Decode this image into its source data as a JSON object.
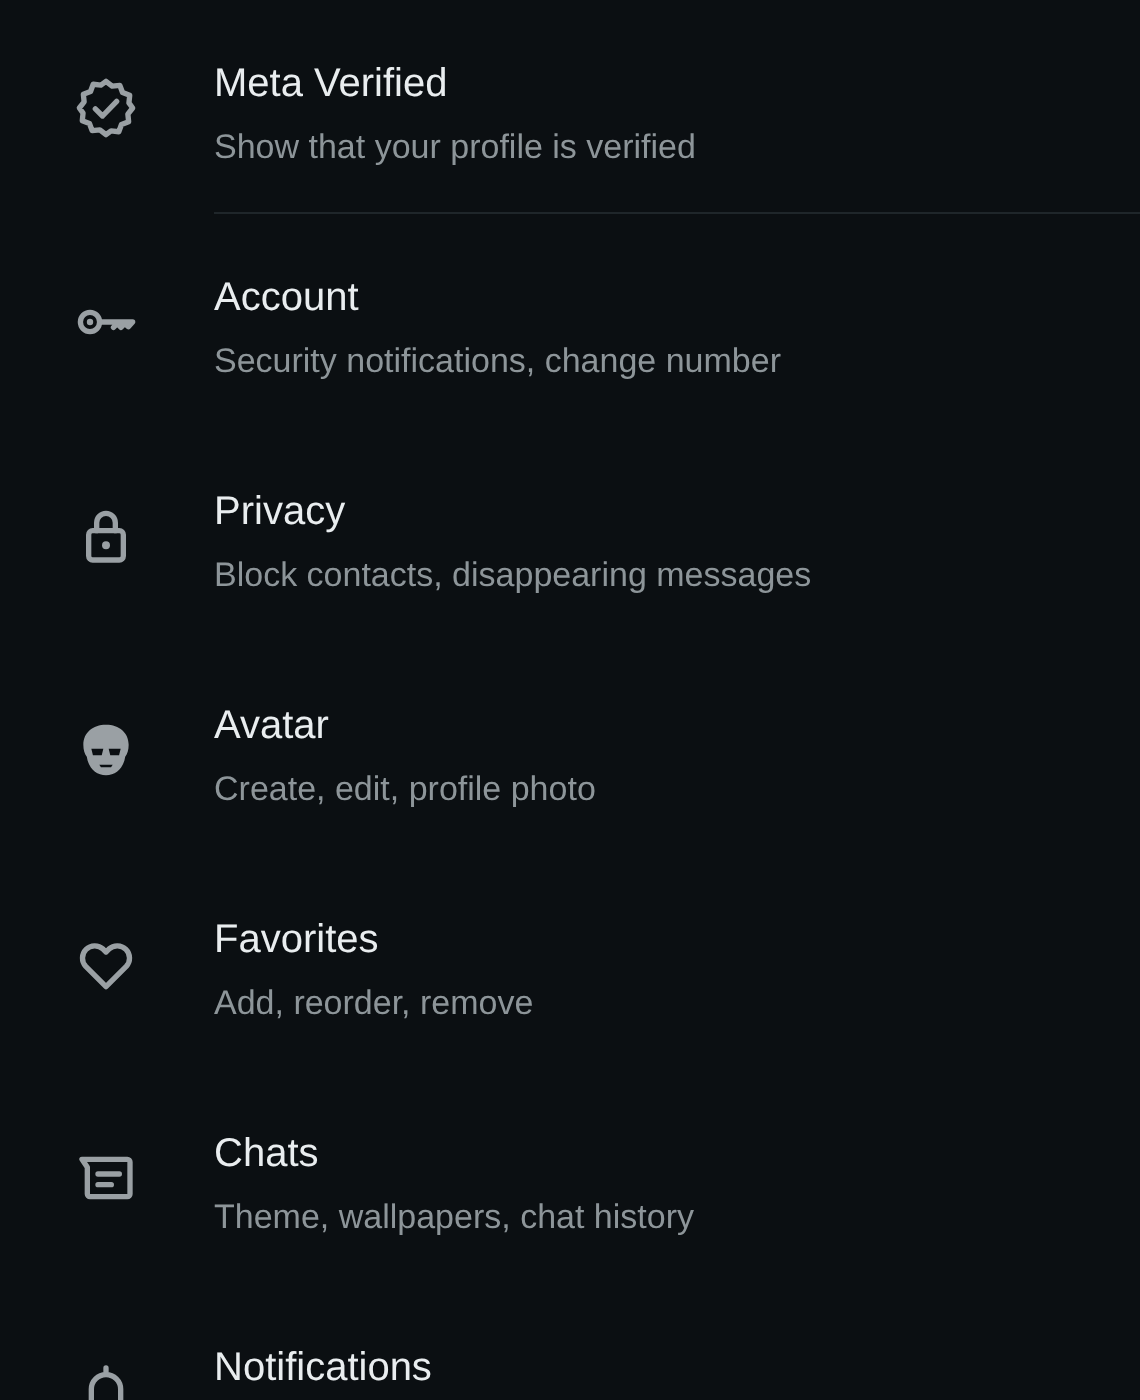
{
  "settings": [
    {
      "title": "Meta Verified",
      "subtitle": "Show that your profile is verified",
      "divider_below": true
    },
    {
      "title": "Account",
      "subtitle": "Security notifications, change number",
      "divider_below": false
    },
    {
      "title": "Privacy",
      "subtitle": "Block contacts, disappearing messages",
      "divider_below": false
    },
    {
      "title": "Avatar",
      "subtitle": "Create, edit, profile photo",
      "divider_below": false
    },
    {
      "title": "Favorites",
      "subtitle": "Add, reorder, remove",
      "divider_below": false
    },
    {
      "title": "Chats",
      "subtitle": "Theme, wallpapers, chat history",
      "divider_below": false
    },
    {
      "title": "Notifications"
    }
  ]
}
